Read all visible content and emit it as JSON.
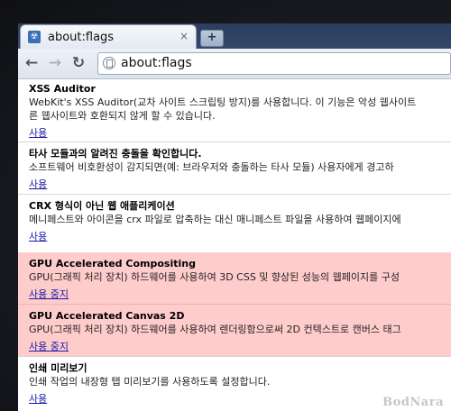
{
  "browser": {
    "tab_title": "about:flags",
    "tab_close": "×",
    "newtab_label": "+",
    "url": "about:flags"
  },
  "experiments": [
    {
      "title": "XSS Auditor",
      "desc_lines": [
        "WebKit's XSS Auditor(교차 사이트 스크립팅 방지)를 사용합니다. 이 기능은 악성 웹사이트",
        "른 웹사이트와 호환되지 않게 할 수 있습니다."
      ],
      "link": "사용",
      "enabled": false
    },
    {
      "title": "타사 모듈과의 알려진 충돌을 확인합니다.",
      "desc_lines": [
        "소프트웨어 비호환성이 감지되면(예: 브라우저와 충돌하는 타사 모듈) 사용자에게 경고하"
      ],
      "link": "사용",
      "enabled": false
    },
    {
      "title": "CRX 형식이 아닌 웹 애플리케이션",
      "desc_lines": [
        "메니페스트와 아이콘을 crx 파일로 압축하는 대신 매니페스트 파일을 사용하여 웹페이지에"
      ],
      "link": "사용",
      "enabled": false
    },
    {
      "title": "GPU Accelerated Compositing",
      "desc_lines": [
        "GPU(그래픽 처리 장치) 하드웨어를 사용하여 3D CSS 및 향상된 성능의 웹페이지를 구성"
      ],
      "link": "사용 중지",
      "enabled": true
    },
    {
      "title": "GPU Accelerated Canvas 2D",
      "desc_lines": [
        "GPU(그래픽 처리 장치) 하드웨어를 사용하여 렌더링함으로써 2D 컨텍스트로 캔버스 태그"
      ],
      "link": "사용 중지",
      "enabled": true
    },
    {
      "title": "인쇄 미리보기",
      "desc_lines": [
        "인쇄 작업의 내장형 탭 미리보기를 사용하도록 설정합니다."
      ],
      "link": "사용",
      "enabled": false
    }
  ],
  "watermark": "BodNara"
}
